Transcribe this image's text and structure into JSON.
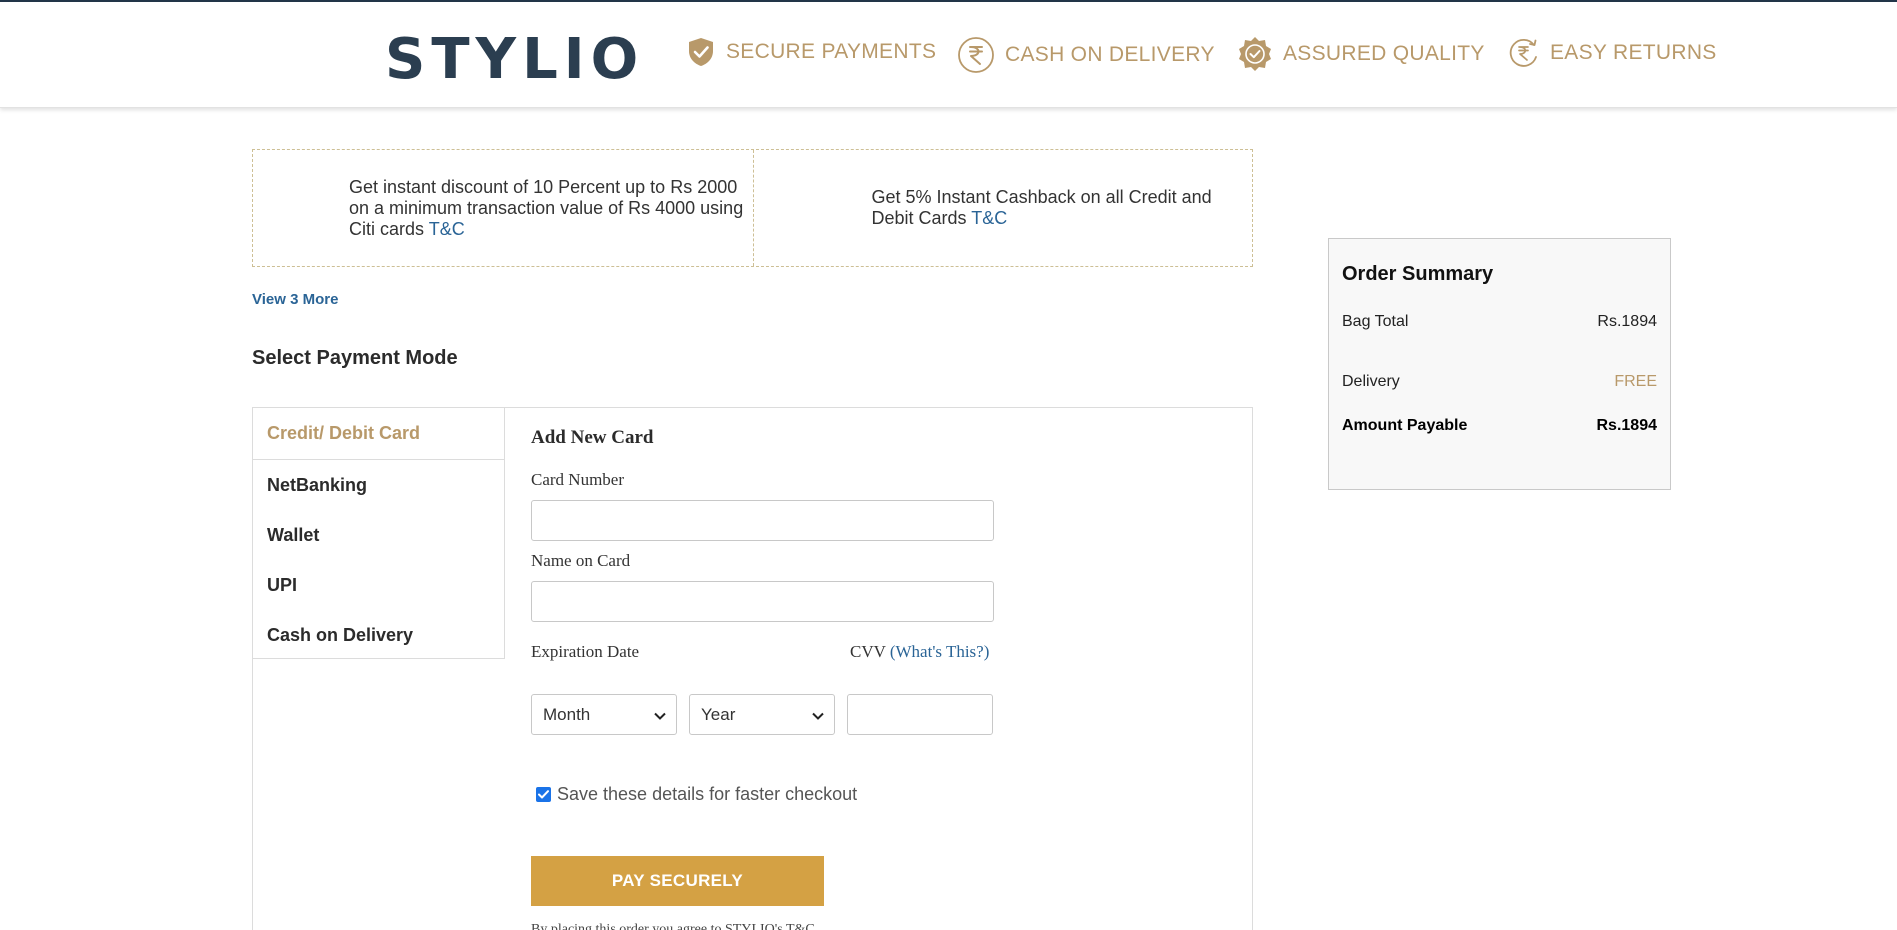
{
  "header": {
    "logo": "STYLIO",
    "badges": [
      {
        "icon": "shield-check-icon",
        "label": "SECURE PAYMENTS"
      },
      {
        "icon": "rupee-coin-icon",
        "label": "CASH ON DELIVERY"
      },
      {
        "icon": "quality-seal-icon",
        "label": "ASSURED QUALITY"
      },
      {
        "icon": "rupee-return-icon",
        "label": "EASY RETURNS"
      }
    ]
  },
  "offers": [
    {
      "lines": [
        "Get instant discount of 10 Percent up to Rs 2000",
        "on a minimum transaction value of Rs 4000 using",
        "Citi cards "
      ],
      "link": "T&C"
    },
    {
      "lines": [
        "Get 5% Instant Cashback on all Credit and",
        "Debit Cards "
      ],
      "link": "T&C"
    }
  ],
  "view_more": "View 3 More",
  "payment": {
    "title": "Select Payment Mode",
    "modes": [
      "Credit/ Debit Card",
      "NetBanking",
      "Wallet",
      "UPI",
      "Cash on Delivery"
    ],
    "active_mode": "Credit/ Debit Card"
  },
  "card_form": {
    "title": "Add New Card",
    "card_number_label": "Card Number",
    "card_number_value": "",
    "name_label": "Name on Card",
    "name_value": "",
    "expiry_label": "Expiration Date",
    "cvv_label": "CVV",
    "cvv_help": "(What's This?)",
    "month_selected": "Month",
    "year_selected": "Year",
    "cvv_value": "",
    "save_label": "Save these details for faster checkout",
    "save_checked": true,
    "pay_button": "PAY SECURELY",
    "terms_text": "By placing this order you agree to STYLIO's T&C"
  },
  "summary": {
    "title": "Order Summary",
    "bag_total_label": "Bag Total",
    "bag_total_value": "Rs.1894",
    "delivery_label": "Delivery",
    "delivery_value": "FREE",
    "amount_label": "Amount Payable",
    "amount_value": "Rs.1894"
  },
  "colors": {
    "brand_dark": "#2b3e50",
    "gold": "#b8996a",
    "button": "#d4a144",
    "link": "#2a6496"
  }
}
